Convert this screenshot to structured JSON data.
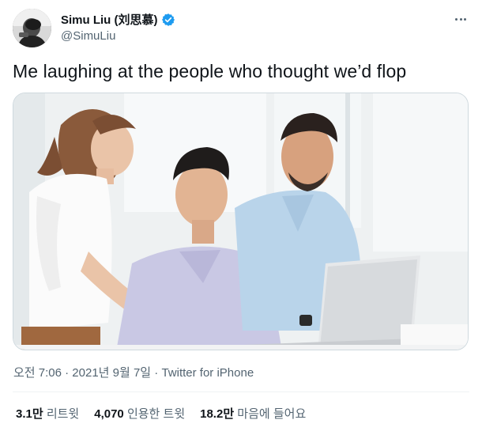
{
  "author": {
    "display_name": "Simu Liu (刘思慕)",
    "handle": "@SimuLiu",
    "verified_icon": "verified-badge-icon",
    "accent_color": "#1d9bf0"
  },
  "tweet": {
    "text": "Me laughing at the people who thought we’d flop",
    "timestamp": "오전 7:06 · 2021년 9월 7일",
    "separator": " · ",
    "source": "Twitter for iPhone"
  },
  "stats": [
    {
      "value": "3.1만",
      "label": "리트윗"
    },
    {
      "value": "4,070",
      "label": "인용한 트윗"
    },
    {
      "value": "18.2만",
      "label": "마음에 들어요"
    }
  ],
  "icons": {
    "more": "more-options-icon"
  }
}
